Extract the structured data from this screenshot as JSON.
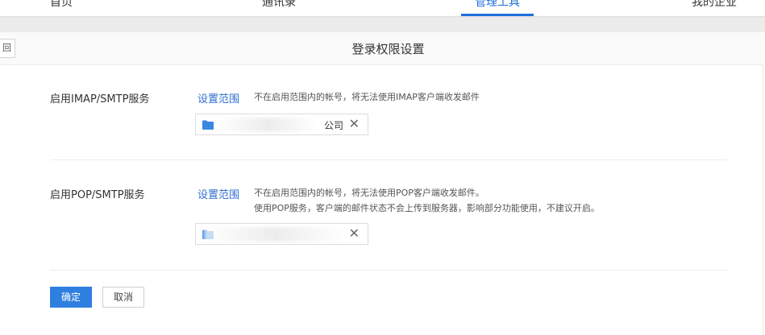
{
  "nav": {
    "items": [
      "首页",
      "通讯录",
      "管理工具",
      "我的企业"
    ],
    "active_index": 2,
    "accent_color": "#1e6fd9"
  },
  "page": {
    "back_label": "回",
    "title": "登录权限设置"
  },
  "imap": {
    "label": "启用IMAP/SMTP服务",
    "link": "设置范围",
    "note": "不在启用范围内的帐号，将无法使用IMAP客户端收发邮件",
    "tag_text": "公司"
  },
  "pop": {
    "label": "启用POP/SMTP服务",
    "link": "设置范围",
    "note_line1": "不在启用范围内的帐号，将无法使用POP客户端收发邮件。",
    "note_line2": "使用POP服务，客户端的邮件状态不会上传到服务器，影响部分功能使用，不建议开启。"
  },
  "actions": {
    "confirm": "确定",
    "cancel": "取消"
  },
  "icons": {
    "folder": "folder-icon",
    "close": "close-icon"
  }
}
